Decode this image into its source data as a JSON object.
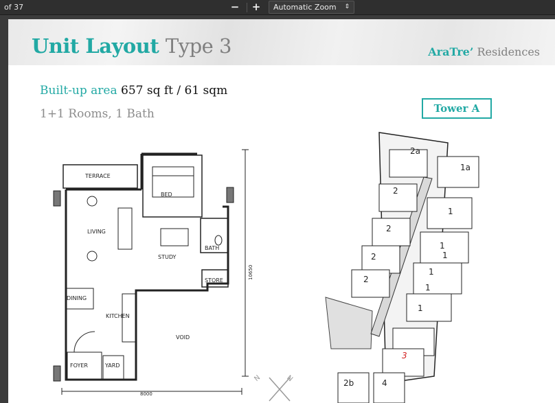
{
  "viewer": {
    "page_count": "of 37",
    "zoom_out": "−",
    "zoom_in": "+",
    "zoom_level": "Automatic Zoom"
  },
  "document": {
    "title_main": "Unit Layout",
    "title_type": "Type 3",
    "brand_name": "AraTre’",
    "brand_suffix": " Residences",
    "builtup_label": "Built-up area",
    "builtup_value": "657 sq ft / 61 sqm",
    "rooms": "1+1 Rooms, 1 Bath",
    "tower": "Tower A"
  },
  "floorplan": {
    "rooms": {
      "terrace": "TERRACE",
      "bed": "BED",
      "living": "LIVING",
      "bath": "BATH",
      "study": "STUDY",
      "store": "STORE",
      "dining": "DINING",
      "kitchen": "KITCHEN",
      "void": "VOID",
      "foyer": "FOYER",
      "yard": "YARD"
    },
    "dim_width": "8000",
    "dim_height": "10650",
    "compass_n1": "N",
    "compass_n2": "N"
  },
  "keyplan": {
    "units": [
      "2a",
      "1a",
      "2",
      "1",
      "2",
      "1",
      "1",
      "2",
      "1",
      "2",
      "1",
      "1",
      "3",
      "2b",
      "4"
    ],
    "highlight": "3",
    "highlight_color": "#d21f1f",
    "accent_color": "#22a9a4"
  }
}
